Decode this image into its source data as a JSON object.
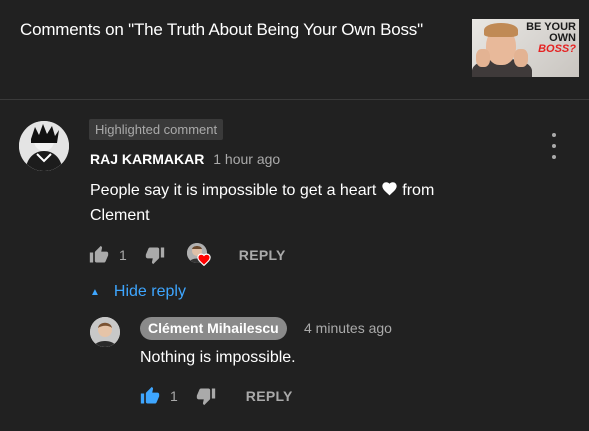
{
  "header": {
    "title": "Comments on \"The Truth About Being Your Own Boss\"",
    "thumbnail": {
      "line1": "BE YOUR",
      "line2": "OWN",
      "line3": "BOSS?"
    }
  },
  "comment": {
    "badge": "Highlighted comment",
    "author": "RAJ KARMAKAR",
    "time": "1 hour ago",
    "text_before_heart": "People say it is impossible to get a heart ",
    "text_after_heart": " from Clement",
    "likes": "1",
    "reply_label": "REPLY",
    "menu_icon": "more-vert-icon"
  },
  "replies_toggle": {
    "label": "Hide reply",
    "icon": "chevron-up-icon"
  },
  "reply": {
    "author": "Clément Mihailescu",
    "time": "4 minutes ago",
    "text": "Nothing is impossible.",
    "likes": "1",
    "reply_label": "REPLY"
  },
  "colors": {
    "background": "#212121",
    "link_blue": "#3ea6ff",
    "heart_red": "#ff0000",
    "muted_text": "#aaaaaa"
  }
}
